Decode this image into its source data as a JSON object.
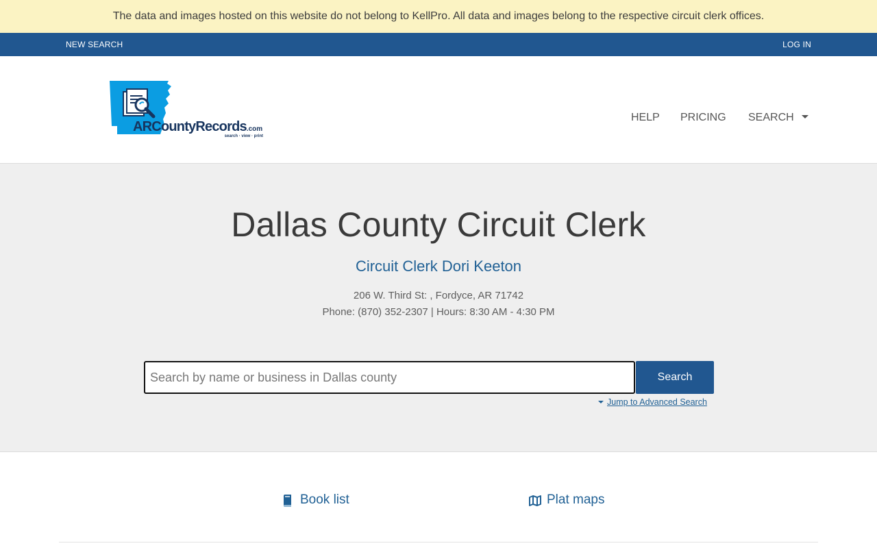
{
  "notice": {
    "text": "The data and images hosted on this website do not belong to KellPro. All data and images belong to the respective circuit clerk offices."
  },
  "topbar": {
    "new_search": "NEW SEARCH",
    "login": "LOG IN"
  },
  "logo": {
    "wordmark_prefix": "AR",
    "wordmark_main": "CountyRecords",
    "wordmark_suffix": ".com",
    "tagline": "search · view · print",
    "colors": {
      "state": "#0b9de2",
      "text": "#17345e"
    }
  },
  "nav": {
    "help": "HELP",
    "pricing": "PRICING",
    "search": "SEARCH"
  },
  "hero": {
    "title": "Dallas County Circuit Clerk",
    "subtitle": "Circuit Clerk Dori Keeton",
    "address": "206 W. Third St: , Fordyce, AR 71742",
    "contact": "Phone: (870) 352-2307 | Hours: 8:30 AM - 4:30 PM"
  },
  "search": {
    "placeholder": "Search by name or business in Dallas county",
    "button": "Search",
    "advanced_link": "Jump to Advanced Search"
  },
  "resources": {
    "book_list": "Book list",
    "plat_maps": "Plat maps"
  },
  "icons": {
    "search_caret": "caret-down-icon",
    "book": "book-icon",
    "map": "map-icon",
    "logo": "arkansas-document-magnifier-logo"
  },
  "theme": {
    "notice_bg": "#fbf3c3",
    "bar_blue": "#215790",
    "link_blue": "#216195",
    "hero_bg": "#efefef"
  }
}
